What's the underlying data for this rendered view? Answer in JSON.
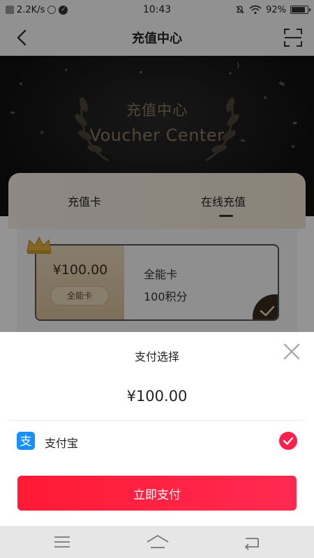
{
  "status_bar": {
    "speed": "2.2K/s",
    "time": "10:43",
    "battery_percent": "92%",
    "battery_level": 0.92
  },
  "nav": {
    "title": "充值中心"
  },
  "hero": {
    "title": "充值中心",
    "subtitle": "Voucher Center"
  },
  "tabs": [
    {
      "label": "充值卡",
      "active": false
    },
    {
      "label": "在线充值",
      "active": true
    }
  ],
  "voucher": {
    "price": "¥100.00",
    "tag": "全能卡",
    "name": "全能卡",
    "points": "100积分",
    "selected": true
  },
  "payment_sheet": {
    "title": "支付选择",
    "amount": "¥100.00",
    "methods": [
      {
        "label": "支付宝",
        "icon": "alipay-icon",
        "selected": true
      }
    ],
    "pay_button_label": "立即支付"
  },
  "colors": {
    "accent": "#ff1f3f",
    "alipay_blue": "#1890ff",
    "gold": "#8a7a5e"
  }
}
